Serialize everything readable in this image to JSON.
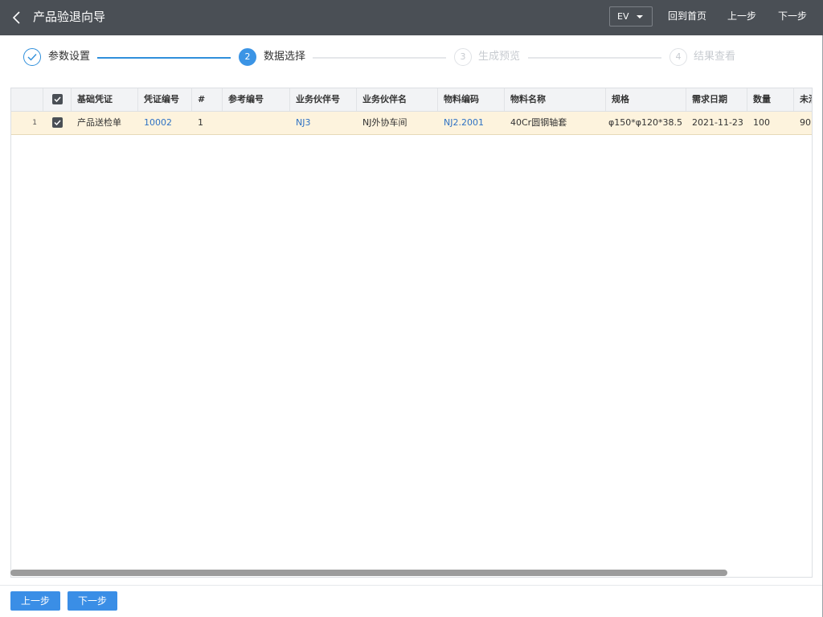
{
  "header": {
    "title": "产品验退向导",
    "env_label": "EV",
    "home_label": "回到首页",
    "prev_label": "上一步",
    "next_label": "下一步",
    "background_color": "#4a4f55"
  },
  "steps": [
    {
      "number": "1",
      "label": "参数设置",
      "status": "done"
    },
    {
      "number": "2",
      "label": "数据选择",
      "status": "active"
    },
    {
      "number": "3",
      "label": "生成预览",
      "status": "pending"
    },
    {
      "number": "4",
      "label": "结果查看",
      "status": "pending"
    }
  ],
  "table": {
    "columns": [
      "基础凭证",
      "凭证编号",
      "#",
      "参考编号",
      "业务伙伴号",
      "业务伙伴名",
      "物料编码",
      "物料名称",
      "规格",
      "需求日期",
      "数量",
      "未清"
    ],
    "rows": [
      {
        "row_number": "1",
        "checked": true,
        "cells": [
          "产品送检单",
          "10002",
          "1",
          "",
          "NJ3",
          "NJ外协车间",
          "NJ2.2001",
          "40Cr圆钢轴套",
          "φ150*φ120*38.5",
          "2021-11-23",
          "100",
          "90"
        ]
      }
    ],
    "link_color": "#2f72c4",
    "selected_row_color": "#fdf3dd"
  },
  "footer": {
    "prev_label": "上一步",
    "next_label": "下一步",
    "button_color": "#3a8ee6"
  }
}
